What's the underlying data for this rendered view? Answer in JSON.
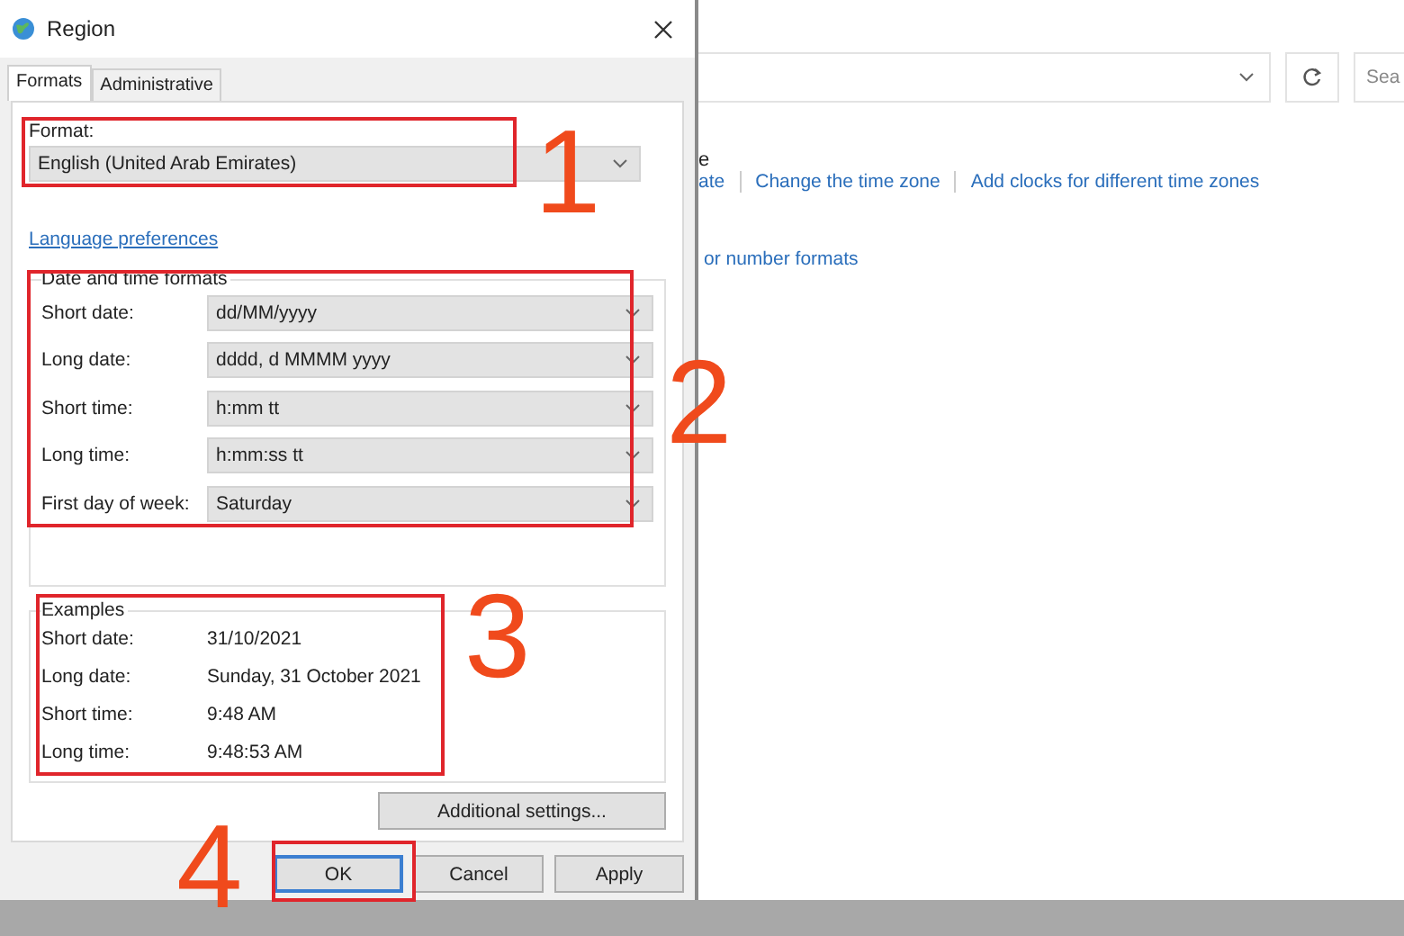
{
  "dialog": {
    "title": "Region",
    "tabs": [
      {
        "label": "Formats",
        "selected": true
      },
      {
        "label": "Administrative",
        "selected": false
      }
    ],
    "format": {
      "label": "Format:",
      "value": "English (United Arab Emirates)"
    },
    "link": "Language preferences",
    "formats_group": {
      "title": "Date and time formats",
      "rows": [
        {
          "label": "Short date:",
          "value": "dd/MM/yyyy"
        },
        {
          "label": "Long date:",
          "value": "dddd, d MMMM yyyy"
        },
        {
          "label": "Short time:",
          "value": "h:mm tt"
        },
        {
          "label": "Long time:",
          "value": "h:mm:ss tt"
        },
        {
          "label": "First day of week:",
          "value": "Saturday"
        }
      ]
    },
    "examples_group": {
      "title": "Examples",
      "rows": [
        {
          "label": "Short date:",
          "value": "31/10/2021"
        },
        {
          "label": "Long date:",
          "value": "Sunday, 31 October 2021"
        },
        {
          "label": "Short time:",
          "value": "9:48 AM"
        },
        {
          "label": "Long time:",
          "value": "9:48:53 AM"
        }
      ]
    },
    "additional_button": "Additional settings...",
    "buttons": [
      {
        "label": "OK",
        "default": true
      },
      {
        "label": "Cancel",
        "default": false
      },
      {
        "label": "Apply",
        "default": false
      }
    ]
  },
  "background_window": {
    "heading_fragment": "e",
    "links": [
      "ate",
      "Change the time zone",
      "Add clocks for different time zones"
    ],
    "link_2": "or number formats",
    "search": {
      "placeholder": "Sea"
    }
  },
  "annotations": [
    "1",
    "2",
    "3",
    "4"
  ]
}
